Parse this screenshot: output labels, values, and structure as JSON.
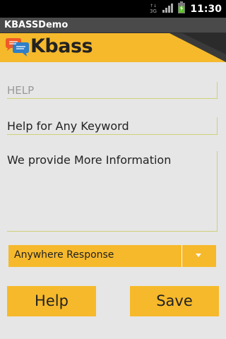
{
  "status_bar": {
    "time": "11:30",
    "network": "3G",
    "icons": [
      "network-3g-icon",
      "signal-icon",
      "battery-icon"
    ]
  },
  "app": {
    "title": "KBASSDemo"
  },
  "header": {
    "logo_text": "Kbass",
    "logo_icon": "chat-bubbles-icon"
  },
  "form": {
    "help_value": "HELP",
    "keyword_value": "Help for Any Keyword",
    "info_value": "We provide More Information",
    "response_select": "Anywhere Response"
  },
  "buttons": {
    "help_label": "Help",
    "save_label": "Save"
  },
  "colors": {
    "accent": "#f6b92b",
    "title_bar": "#4a4a4a",
    "field_line": "#cfd07a",
    "background": "#e6e6e6"
  }
}
